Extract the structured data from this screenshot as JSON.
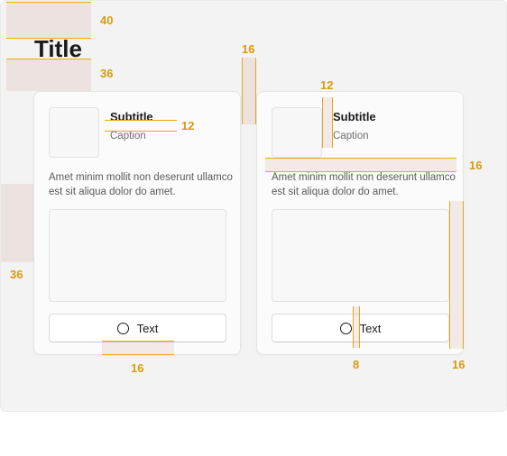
{
  "page": {
    "title": "Title"
  },
  "cards": [
    {
      "subtitle": "Subtitle",
      "caption": "Caption",
      "body": "Amet minim mollit non deserunt ullamco est sit aliqua dolor do amet.",
      "button_label": "Text",
      "button_icon": "circle-icon"
    },
    {
      "subtitle": "Subtitle",
      "caption": "Caption",
      "body": "Amet minim mollit non deserunt ullamco est sit aliqua dolor do amet.",
      "button_label": "Text",
      "button_icon": "circle-icon"
    }
  ],
  "measurements": {
    "title_top": "40",
    "title_bottom": "36",
    "card_left": "36",
    "card_top": "16",
    "thumb_text_gap": "12",
    "card1_button_bottom": "16",
    "card2_thumb_text_gap": "12",
    "card2_section_gap": "16",
    "icon_label_gap": "8",
    "card2_right": "16"
  },
  "colors": {
    "redline": "#e8a817",
    "redline_text": "#d99a10",
    "spacing_fill": "#d8aaa0",
    "canvas": "#f3f3f3",
    "card": "#fbfbfb"
  }
}
